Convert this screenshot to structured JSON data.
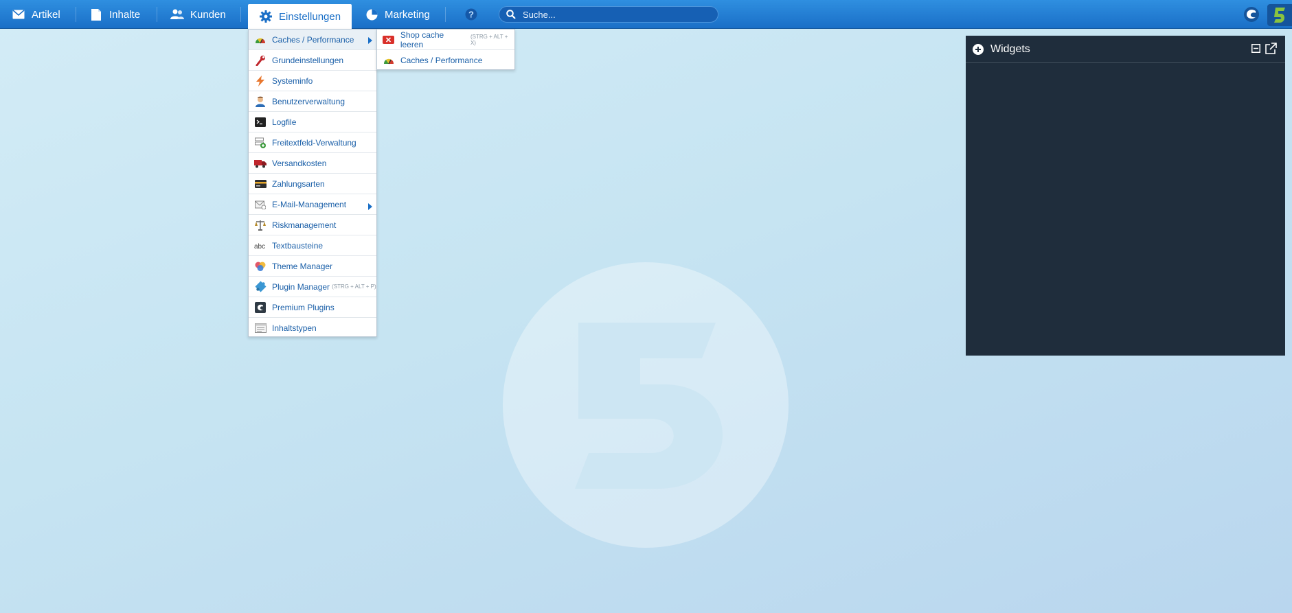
{
  "nav": {
    "items": [
      {
        "label": "Artikel",
        "icon": "envelope-icon"
      },
      {
        "label": "Inhalte",
        "icon": "document-icon"
      },
      {
        "label": "Kunden",
        "icon": "users-icon"
      },
      {
        "label": "Einstellungen",
        "icon": "gear-icon",
        "active": true
      },
      {
        "label": "Marketing",
        "icon": "pie-chart-icon"
      }
    ],
    "help_icon": "help-icon",
    "search_placeholder": "Suche..."
  },
  "settings_menu": {
    "items": [
      {
        "label": "Caches / Performance",
        "icon": "speedometer-icon",
        "has_submenu": true
      },
      {
        "label": "Grundeinstellungen",
        "icon": "wrench-icon"
      },
      {
        "label": "Systeminfo",
        "icon": "lightning-icon"
      },
      {
        "label": "Benutzerverwaltung",
        "icon": "user-icon"
      },
      {
        "label": "Logfile",
        "icon": "terminal-icon"
      },
      {
        "label": "Freitextfeld-Verwaltung",
        "icon": "form-add-icon"
      },
      {
        "label": "Versandkosten",
        "icon": "truck-icon"
      },
      {
        "label": "Zahlungsarten",
        "icon": "credit-card-icon"
      },
      {
        "label": "E-Mail-Management",
        "icon": "mail-icon",
        "has_submenu": true
      },
      {
        "label": "Riskmanagement",
        "icon": "scales-icon"
      },
      {
        "label": "Textbausteine",
        "icon": "abc-icon"
      },
      {
        "label": "Theme Manager",
        "icon": "color-circles-icon"
      },
      {
        "label": "Plugin Manager",
        "icon": "puzzle-icon",
        "shortcut": "(STRG + ALT + P)"
      },
      {
        "label": "Premium Plugins",
        "icon": "shopware-logo-icon"
      },
      {
        "label": "Inhaltstypen",
        "icon": "list-window-icon"
      }
    ]
  },
  "cache_submenu": {
    "items": [
      {
        "label": "Shop cache leeren",
        "icon": "clear-cache-icon",
        "shortcut": "(STRG + ALT + X)"
      },
      {
        "label": "Caches / Performance",
        "icon": "speedometer-icon"
      }
    ]
  },
  "widgets": {
    "title": "Widgets"
  },
  "colors": {
    "topbar": "#1a6fc7",
    "link": "#1a5fa8",
    "widgets_bg": "#1f2d3c",
    "brand_green": "#8ac43f"
  }
}
